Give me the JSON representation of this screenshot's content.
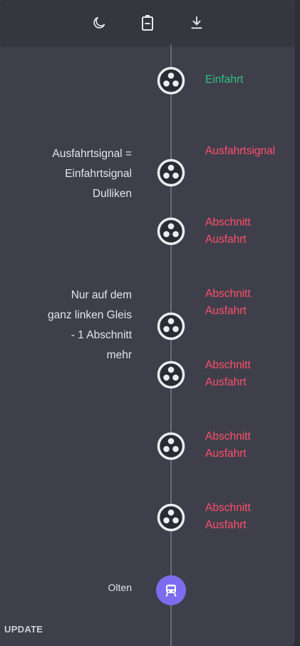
{
  "toolbar": {
    "icons": [
      "moon-icon",
      "battery-icon",
      "download-icon"
    ]
  },
  "timeline": [
    {
      "label": "Einfahrt",
      "label_color": "#2ec27e",
      "note": ""
    },
    {
      "label": "Ausfahrtsignal",
      "label_color": "#ff4f6a",
      "note": "Ausfahrtsignal =\nEinfahrtsignal\nDulliken"
    },
    {
      "label": "Abschnitt\nAusfahrt",
      "label_color": "#ff4f6a",
      "note": ""
    },
    {
      "label": "Abschnitt\nAusfahrt",
      "label_color": "#ff4f6a",
      "note": "Nur auf dem\nganz linken Gleis\n- 1 Abschnitt\nmehr"
    },
    {
      "label": "Abschnitt\nAusfahrt",
      "label_color": "#ff4f6a",
      "note": ""
    },
    {
      "label": "Abschnitt\nAusfahrt",
      "label_color": "#ff4f6a",
      "note": ""
    },
    {
      "label": "Abschnitt\nAusfahrt",
      "label_color": "#ff4f6a",
      "note": ""
    }
  ],
  "station": {
    "name": "Olten",
    "icon": "train-icon",
    "color": "#7e6cf0"
  },
  "footer": {
    "update_label": "UPDATE"
  }
}
